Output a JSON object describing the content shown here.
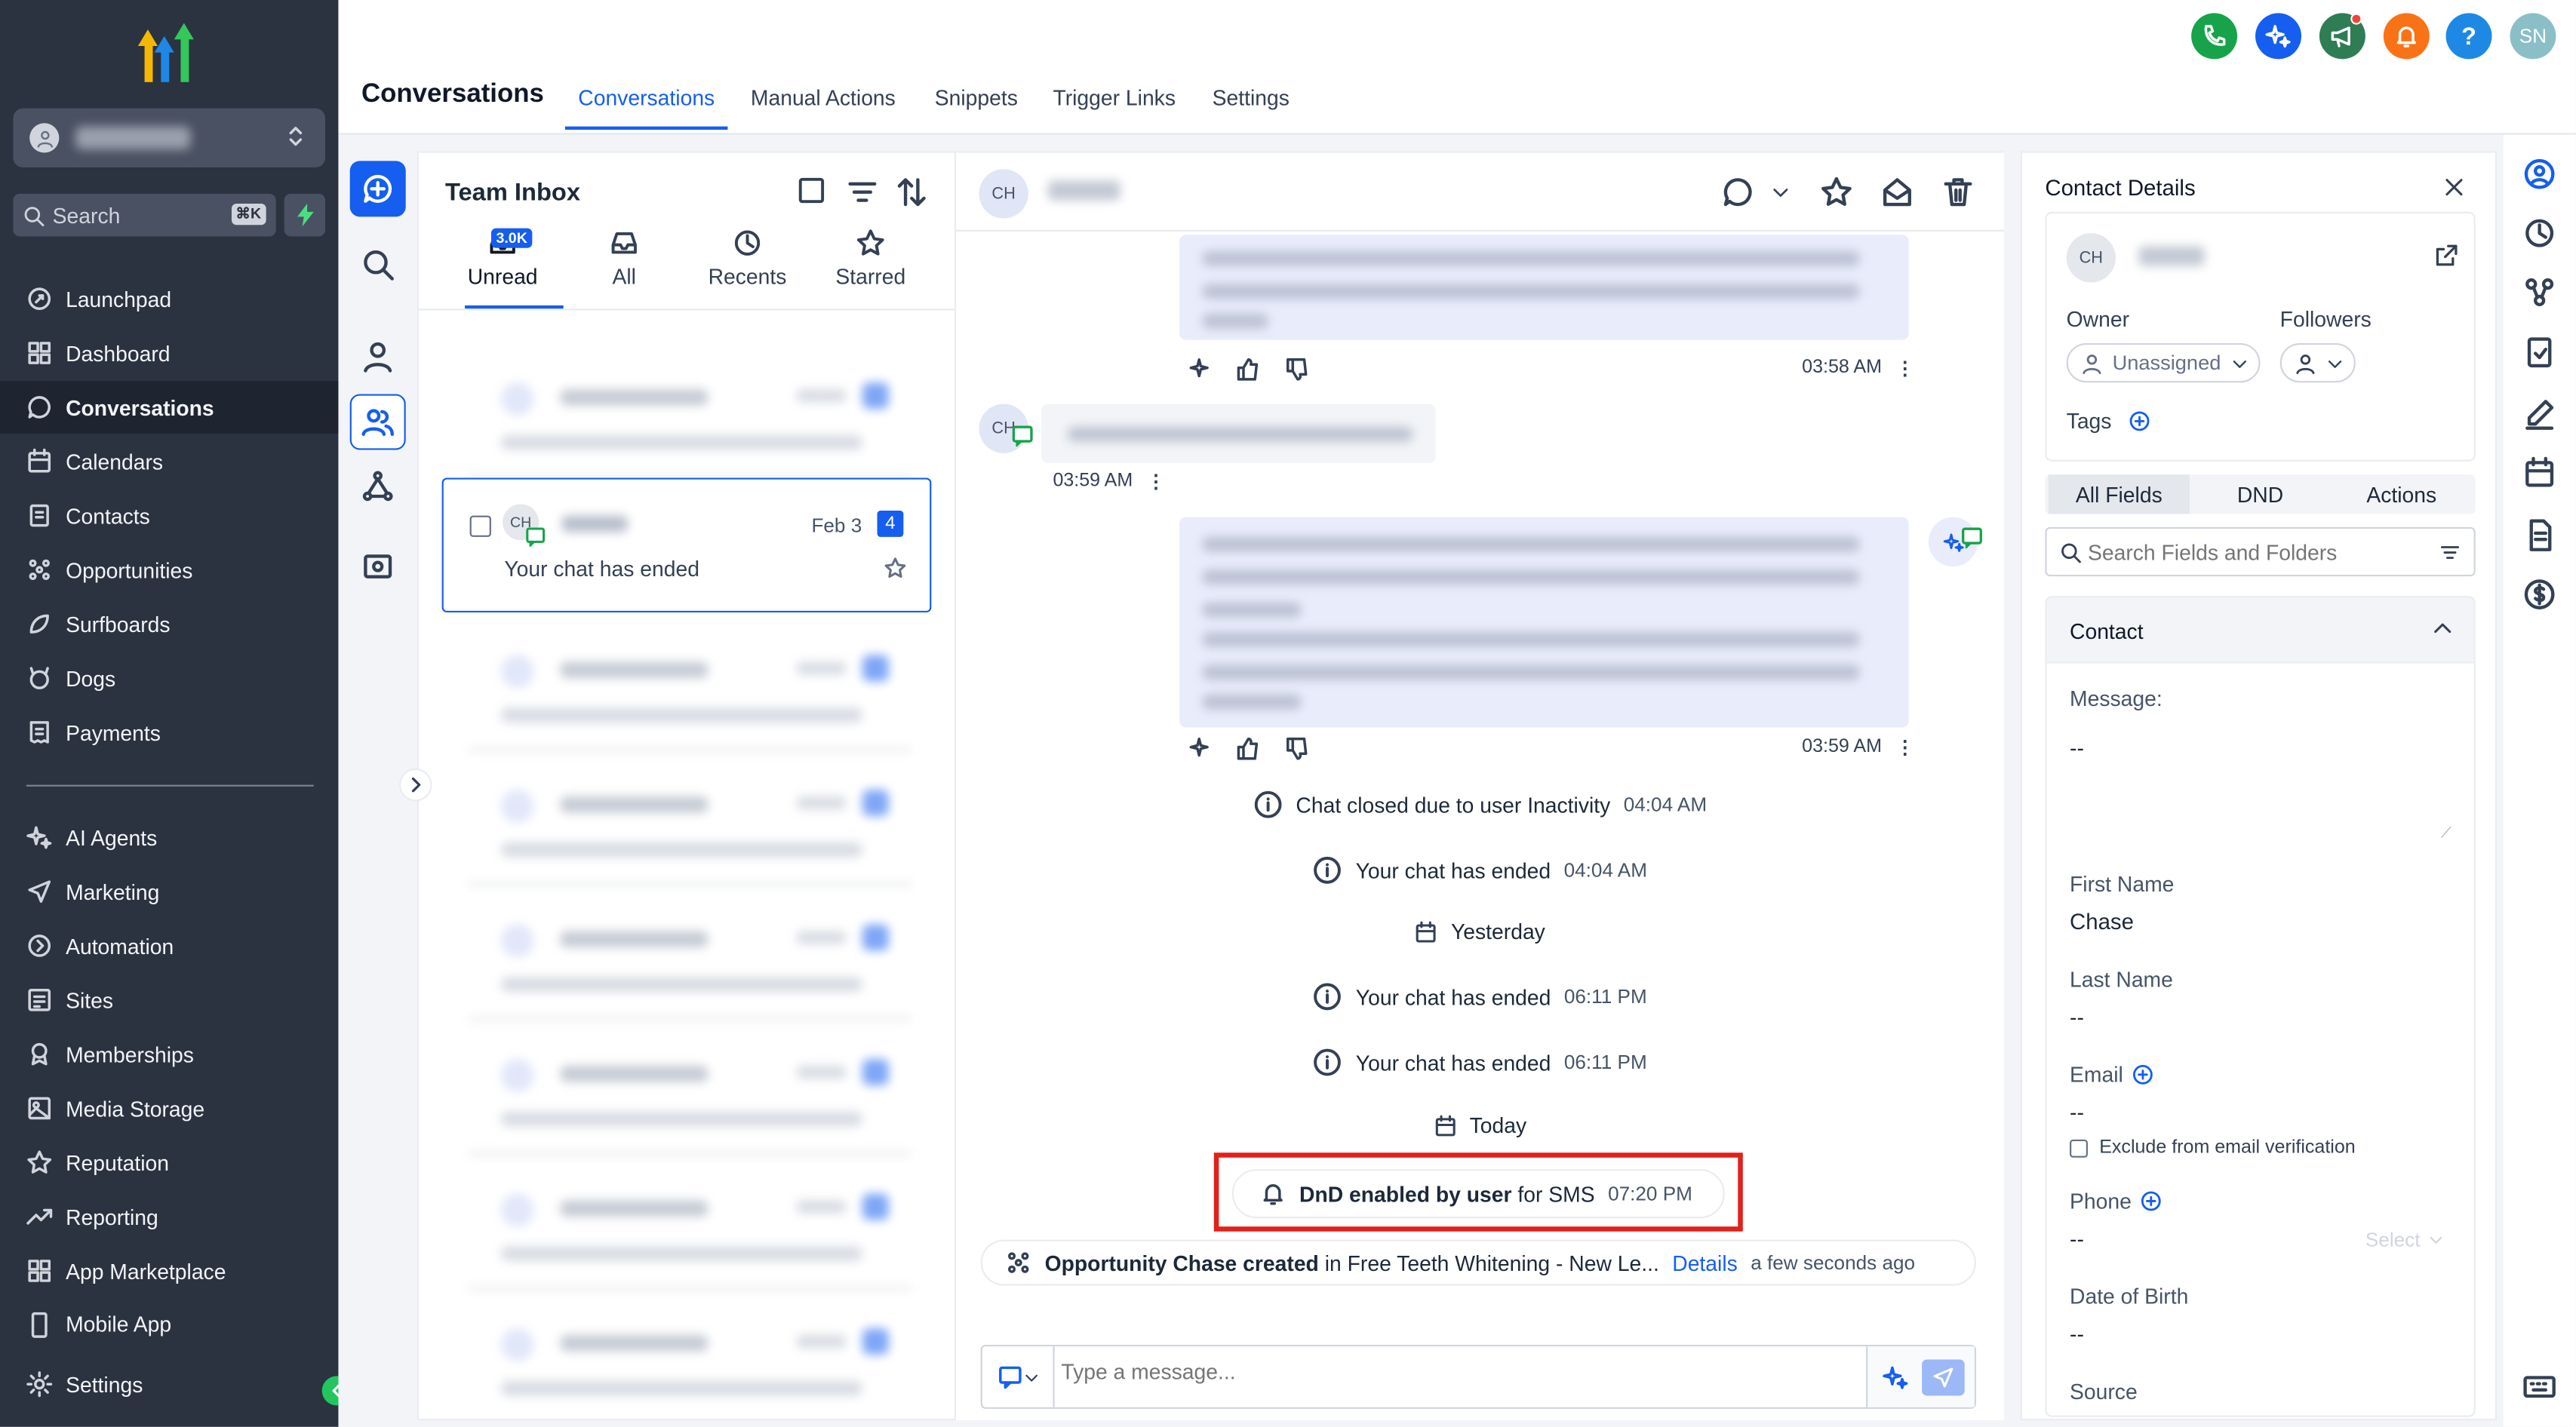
{
  "sidebar": {
    "search_label": "Search",
    "search_shortcut": "⌘K",
    "items": [
      {
        "label": "Launchpad"
      },
      {
        "label": "Dashboard"
      },
      {
        "label": "Conversations"
      },
      {
        "label": "Calendars"
      },
      {
        "label": "Contacts"
      },
      {
        "label": "Opportunities"
      },
      {
        "label": "Surfboards"
      },
      {
        "label": "Dogs"
      },
      {
        "label": "Payments"
      },
      {
        "label": "AI Agents"
      },
      {
        "label": "Marketing"
      },
      {
        "label": "Automation"
      },
      {
        "label": "Sites"
      },
      {
        "label": "Memberships"
      },
      {
        "label": "Media Storage"
      },
      {
        "label": "Reputation"
      },
      {
        "label": "Reporting"
      },
      {
        "label": "App Marketplace"
      },
      {
        "label": "Mobile App"
      }
    ],
    "settings_label": "Settings",
    "active_item": "Conversations"
  },
  "header": {
    "page_title": "Conversations",
    "tabs": [
      {
        "label": "Conversations"
      },
      {
        "label": "Manual Actions"
      },
      {
        "label": "Snippets"
      },
      {
        "label": "Trigger Links"
      },
      {
        "label": "Settings"
      }
    ],
    "active_tab": "Conversations",
    "user_initials": "SN",
    "help_label": "?"
  },
  "inbox": {
    "title": "Team Inbox",
    "tabs": [
      {
        "label": "Unread",
        "badge": "3.0K"
      },
      {
        "label": "All"
      },
      {
        "label": "Recents"
      },
      {
        "label": "Starred"
      }
    ],
    "selected": {
      "initials": "CH",
      "date": "Feb 3",
      "count": "4",
      "preview": "Your chat has ended"
    }
  },
  "chat": {
    "initials": "CH",
    "times": [
      "03:58 AM",
      "03:59 AM",
      "03:59 AM"
    ],
    "events": [
      {
        "text": "Chat closed due to user Inactivity",
        "time": "04:04 AM"
      },
      {
        "text": "Your chat has ended",
        "time": "04:04 AM"
      },
      {
        "text": "Yesterday",
        "time": ""
      },
      {
        "text": "Your chat has ended",
        "time": "06:11 PM"
      },
      {
        "text": "Your chat has ended",
        "time": "06:11 PM"
      },
      {
        "text": "Today",
        "time": ""
      }
    ],
    "dnd": {
      "bold": "DnD enabled by user",
      "rest": "for SMS",
      "time": "07:20 PM"
    },
    "opportunity": {
      "bold": "Opportunity Chase created",
      "rest": "in Free Teeth Whitening - New Le...",
      "link": "Details",
      "time": "a few seconds ago"
    },
    "composer_placeholder": "Type a message..."
  },
  "details": {
    "title": "Contact Details",
    "initials": "CH",
    "owner_label": "Owner",
    "owner_value": "Unassigned",
    "followers_label": "Followers",
    "tags_label": "Tags",
    "segments": [
      {
        "label": "All Fields"
      },
      {
        "label": "DND"
      },
      {
        "label": "Actions"
      }
    ],
    "search_placeholder": "Search Fields and Folders",
    "section": "Contact",
    "fields": {
      "message_label": "Message:",
      "message_value": "--",
      "first_name_label": "First Name",
      "first_name_value": "Chase",
      "last_name_label": "Last Name",
      "last_name_value": "--",
      "email_label": "Email",
      "email_value": "--",
      "exclude_label": "Exclude from email verification",
      "phone_label": "Phone",
      "phone_value": "--",
      "phone_select": "Select",
      "dob_label": "Date of Birth",
      "dob_value": "--",
      "source_label": "Source"
    }
  },
  "colors": {
    "accent": "#155eef",
    "sidebar_bg": "#2b3240",
    "highlight": "#e3201b"
  }
}
